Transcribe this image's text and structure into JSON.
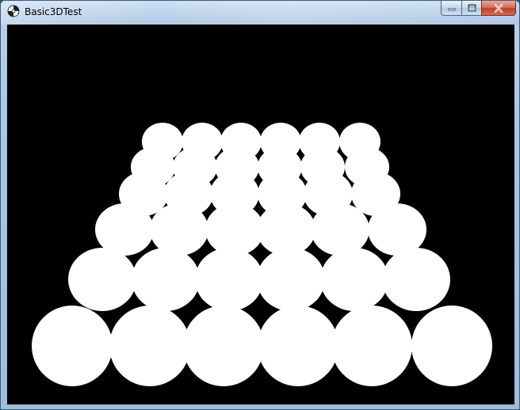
{
  "window": {
    "title": "Basic3DTest",
    "app_icon": "directx-app-icon"
  },
  "caption_buttons": {
    "minimize_icon": "minimize-icon",
    "maximize_icon": "maximize-icon",
    "close_icon": "close-icon"
  },
  "scene": {
    "background_color": "#000000",
    "sphere_color": "#ffffff",
    "rows": 6,
    "columns": 6
  }
}
